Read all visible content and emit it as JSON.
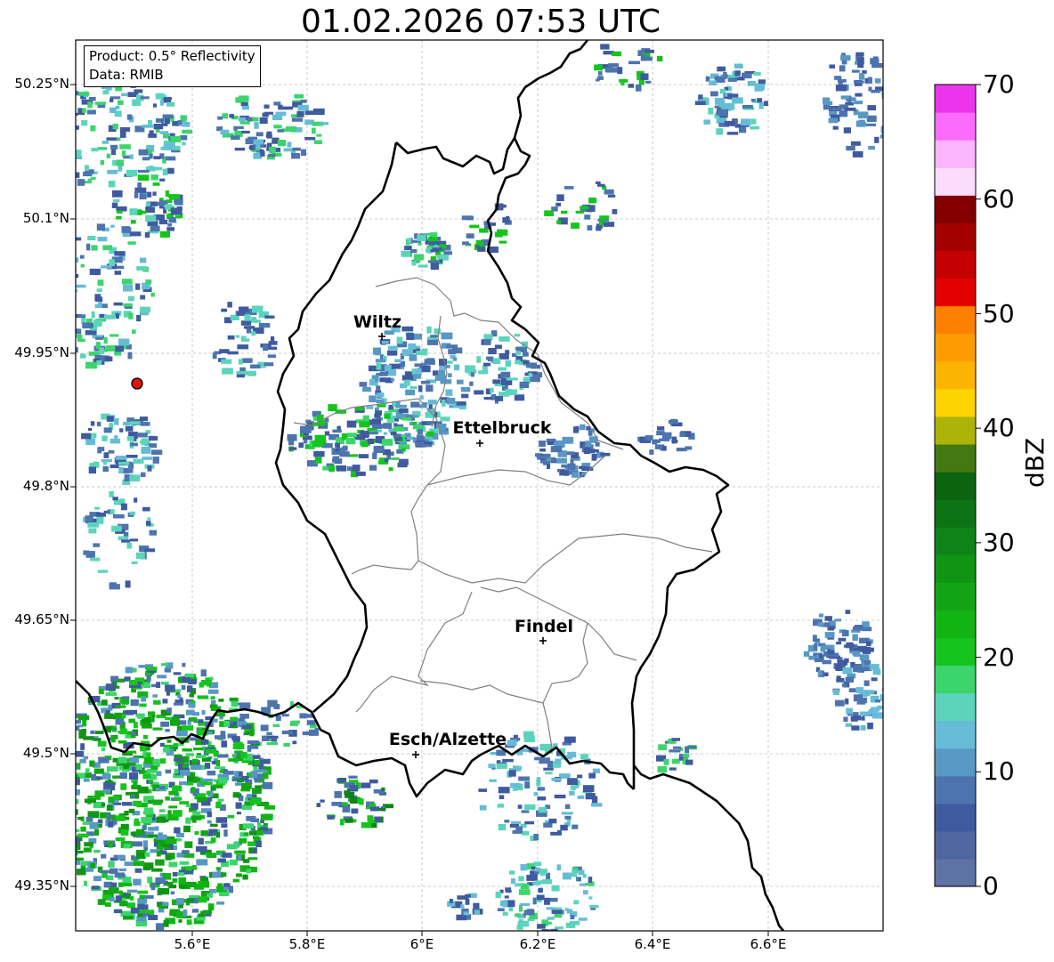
{
  "title": "01.02.2026 07:53 UTC",
  "info": {
    "product": "Product: 0.5° Reflectivity",
    "data": "Data: RMIB"
  },
  "cities": [
    {
      "name": "Wiltz"
    },
    {
      "name": "Ettelbruck"
    },
    {
      "name": "Findel"
    },
    {
      "name": "Esch/Alzette"
    }
  ],
  "lat_ticks": [
    "50.25°N",
    "50.1°N",
    "49.95°N",
    "49.8°N",
    "49.65°N",
    "49.5°N",
    "49.35°N"
  ],
  "lon_ticks": [
    "5.6°E",
    "5.8°E",
    "6°E",
    "6.2°E",
    "6.4°E",
    "6.6°E"
  ],
  "colorbar": {
    "label": "dBZ",
    "ticks": [
      "0",
      "10",
      "20",
      "30",
      "40",
      "50",
      "60",
      "70"
    ],
    "colors": [
      "#5f72a6",
      "#4f66a0",
      "#3f5a9e",
      "#4d74ae",
      "#5898c4",
      "#66bcd6",
      "#5cd4bc",
      "#3cd46c",
      "#16c41e",
      "#12b414",
      "#12a414",
      "#109414",
      "#0e8418",
      "#0c7414",
      "#0a6410",
      "#447812",
      "#acb408",
      "#fcd400",
      "#fcb400",
      "#fc9c00",
      "#fc8000",
      "#e40000",
      "#c40000",
      "#a40000",
      "#840000",
      "#fcdcfc",
      "#fcb4fc",
      "#fc6cfc",
      "#ec34ec"
    ]
  },
  "radar_site": {
    "name": "radar-site"
  }
}
